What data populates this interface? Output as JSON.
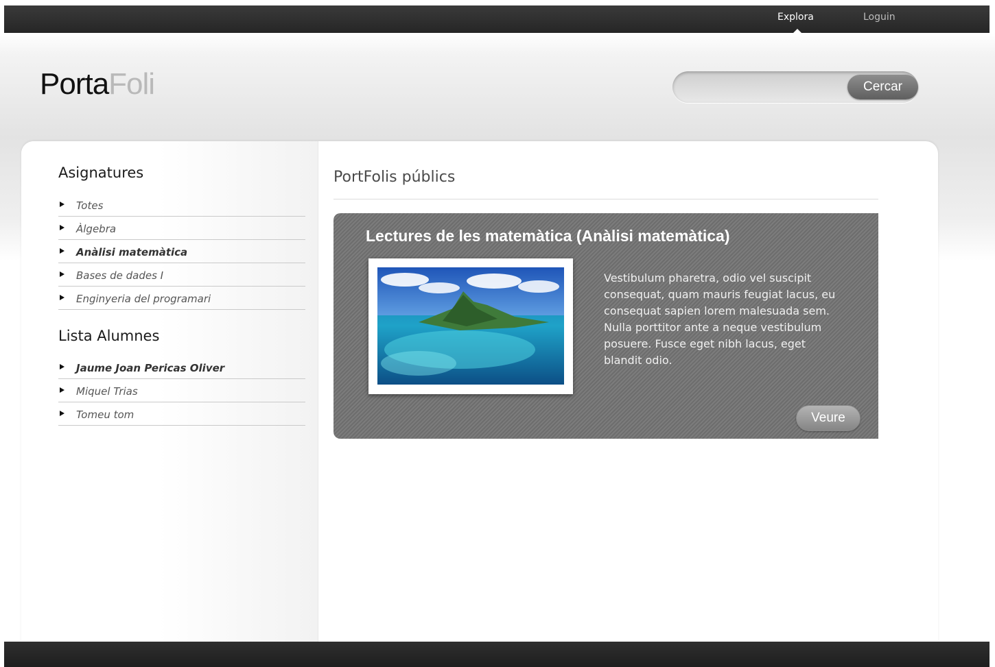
{
  "nav": {
    "items": [
      {
        "label": "Explora",
        "active": true
      },
      {
        "label": "Loguin",
        "active": false
      }
    ]
  },
  "logo": {
    "part1": "Porta",
    "part2": "Foli"
  },
  "search": {
    "value": "",
    "placeholder": "",
    "button_label": "Cercar"
  },
  "sidebar": {
    "subjects_heading": "Asignatures",
    "subjects": [
      {
        "label": "Totes",
        "selected": false
      },
      {
        "label": "Àlgebra",
        "selected": false
      },
      {
        "label": "Anàlisi matemàtica",
        "selected": true
      },
      {
        "label": "Bases de dades I",
        "selected": false
      },
      {
        "label": "Enginyeria del programari",
        "selected": false
      }
    ],
    "students_heading": "Lista Alumnes",
    "students": [
      {
        "label": "Jaume Joan Pericas Oliver",
        "selected": true
      },
      {
        "label": "Miquel Trias",
        "selected": false
      },
      {
        "label": "Tomeu tom",
        "selected": false
      }
    ]
  },
  "main": {
    "title": "PortFolis públics",
    "card": {
      "title": "Lectures de les matemàtica (Anàlisi matemàtica)",
      "description": "Vestibulum pharetra, odio vel suscipit consequat, quam mauris feugiat lacus, eu consequat sapien lorem malesuada sem. Nulla porttitor ante a neque vestibulum posuere. Fusce eget nibh lacus, eget blandit odio.",
      "button_label": "Veure"
    }
  },
  "colors": {
    "topbar": "#2b2b2b",
    "logo_dark": "#111111",
    "logo_light": "#b9b9b9",
    "card_bg": "#747474"
  }
}
